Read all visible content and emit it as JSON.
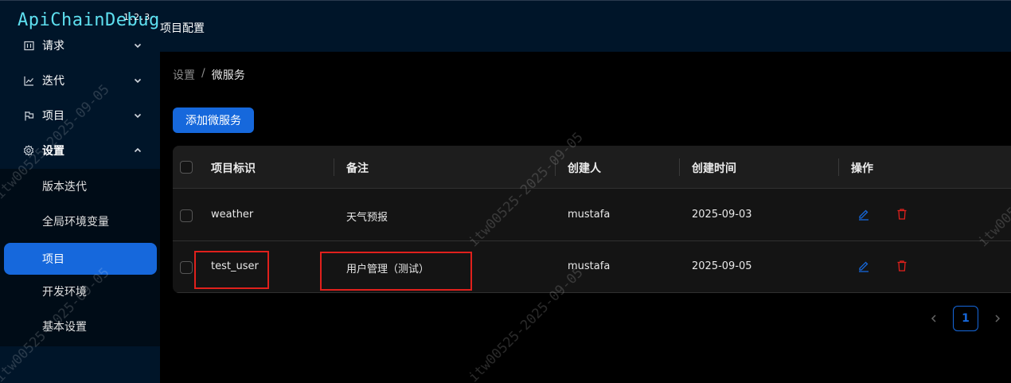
{
  "header": {
    "logo": "ApiChainDebug",
    "version": "1.2.3",
    "title": "项目配置"
  },
  "sidebar": {
    "items": [
      {
        "label": "请求",
        "icon": "calendar-icon"
      },
      {
        "label": "迭代",
        "icon": "line-chart-icon"
      },
      {
        "label": "项目",
        "icon": "flag-icon"
      },
      {
        "label": "设置",
        "icon": "gear-icon"
      }
    ],
    "settings_sub": [
      {
        "label": "版本迭代"
      },
      {
        "label": "全局环境变量"
      },
      {
        "label": "项目",
        "active": true
      },
      {
        "label": "开发环境"
      },
      {
        "label": "基本设置"
      }
    ]
  },
  "breadcrumb": {
    "parent": "设置",
    "separator": "/",
    "current": "微服务"
  },
  "add_button": "添加微服务",
  "table": {
    "columns": [
      "项目标识",
      "备注",
      "创建人",
      "创建时间",
      "操作"
    ],
    "rows": [
      {
        "id": "weather",
        "note": "天气预报",
        "creator": "mustafa",
        "created": "2025-09-03"
      },
      {
        "id": "test_user",
        "note": "用户管理（测试）",
        "creator": "mustafa",
        "created": "2025-09-05"
      }
    ]
  },
  "pagination": {
    "current": "1"
  },
  "watermark": "itw00525-2025-09-05",
  "colors": {
    "sidebar_bg": "#001529",
    "accent": "#1668dc",
    "danger": "#e0201c",
    "logo": "#5ee0f0"
  }
}
